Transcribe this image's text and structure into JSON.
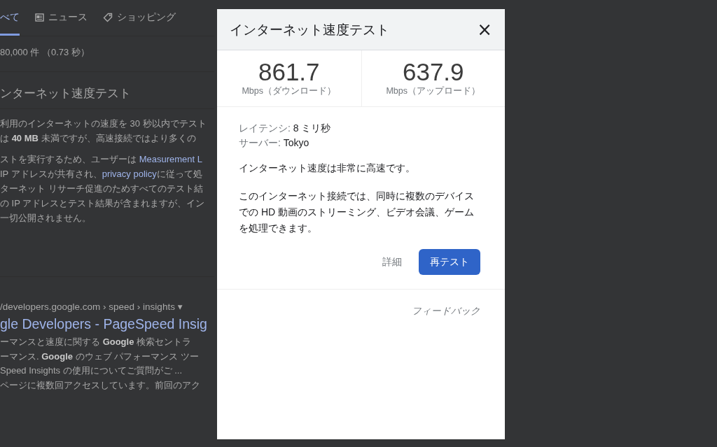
{
  "background": {
    "tabs": [
      {
        "label": "べて",
        "selected": true
      },
      {
        "label": "ニュース",
        "selected": false
      },
      {
        "label": "ショッピング",
        "selected": false
      }
    ],
    "result_count": "80,000 件 （0.73 秒）",
    "heading": "ンターネット速度テスト",
    "paragraphs": [
      [
        "利用のインターネットの速度を 30 秒以内でテスト",
        "は **40 MB** 未満ですが、高速接続ではより多くの"
      ],
      [
        [
          {
            "text": "ストを実行するため、ユーザーは ",
            "link": false
          },
          {
            "text": "Measurement L",
            "link": true
          }
        ],
        [
          {
            "text": "IP アドレスが共有され、",
            "link": false
          },
          {
            "text": "privacy policy",
            "link": true
          },
          {
            "text": "に従って処",
            "link": false
          }
        ],
        "ターネット リサーチ促進のためすべてのテスト結",
        "の IP アドレスとテスト結果が含まれますが、イン",
        "一切公開されません。"
      ]
    ],
    "result": {
      "url": "/developers.google.com › speed › insights ▾",
      "title": "gle Developers - PageSpeed Insig",
      "snippet": [
        "ーマンスと速度に関する **Google** 検索セントラ",
        "ーマンス. **Google** のウェブ パフォーマンス ツー",
        "Speed Insights の使用についてご質問がご ...",
        "ページに複数回アクセスしています。前回のアク"
      ]
    }
  },
  "dialog": {
    "title": "インターネット速度テスト",
    "close": "×",
    "speeds": [
      {
        "value": "861.7",
        "unit": "Mbps（ダウンロード）"
      },
      {
        "value": "637.9",
        "unit": "Mbps（アップロード）"
      }
    ],
    "details": [
      {
        "label": "レイテンシ:",
        "value": "8 ミリ秒"
      },
      {
        "label": "サーバー:",
        "value": "Tokyo"
      }
    ],
    "summary": "インターネット速度は非常に高速です。",
    "description": "このインターネット接続では、同時に複数のデバイスでの HD 動画のストリーミング、ビデオ会議、ゲームを処理できます。",
    "buttons": [
      {
        "label": "詳細",
        "kind": "text"
      },
      {
        "label": "再テスト",
        "kind": "primary"
      }
    ],
    "feedback": "フィードバック"
  }
}
